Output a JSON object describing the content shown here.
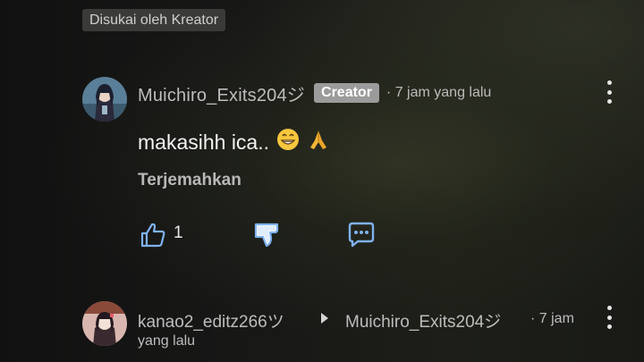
{
  "chip_label": "Disukai oleh Kreator",
  "comment": {
    "username": "Muichiro_Exits204ジ",
    "badge": "Creator",
    "time": "· 7 jam yang lalu",
    "text": "makasihh ica..",
    "emoji1": "😁",
    "emoji2": "🙏",
    "translate": "Terjemahkan",
    "like_count": "1"
  },
  "reply": {
    "username": "kanao2_editz266ツ",
    "reply_to": "Muichiro_Exits204ジ",
    "time_part1": "· 7 jam",
    "time_part2": "yang lalu"
  },
  "icons": {
    "like": "thumbs-up-icon",
    "dislike": "thumbs-down-icon",
    "reply": "reply-icon",
    "menu": "more-vertical-icon"
  }
}
